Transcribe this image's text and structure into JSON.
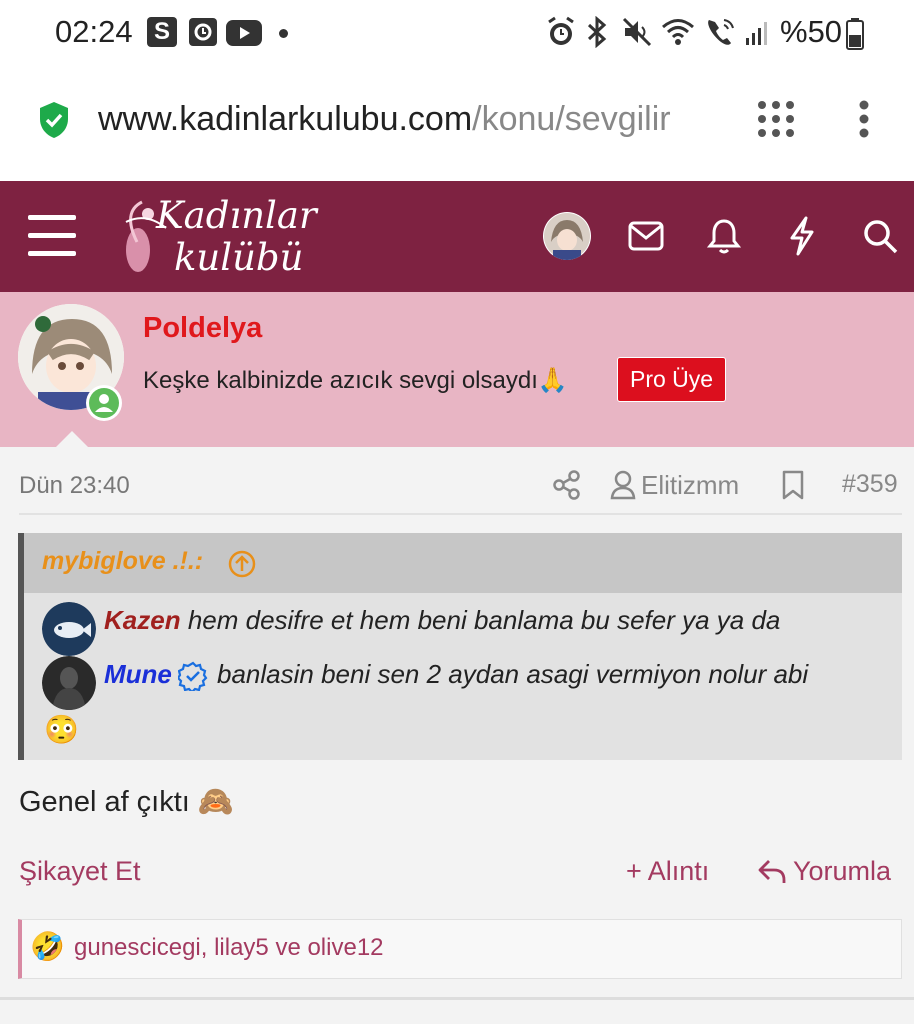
{
  "status_bar": {
    "time": "02:24",
    "s_badge": "S",
    "battery": "%50"
  },
  "browser": {
    "url_host": "www.kadinlarkulubu.com",
    "url_path": "/konu/sevgilir"
  },
  "site": {
    "logo_line1": "Kadınlar",
    "logo_line2": "kulübü",
    "header_color": "#7e2241"
  },
  "post": {
    "username": "Poldelya",
    "user_status": "Keşke kalbinizde azıcık sevgi olsaydı🙏",
    "badge": "Pro Üye",
    "date": "Dün 23:40",
    "author": "Elitizmm",
    "number": "#359",
    "quote": {
      "author": "mybiglove .!.:",
      "lines": [
        {
          "name": "Kazen",
          "text": "hem desifre et hem beni banlama bu sefer ya ya da"
        },
        {
          "name": "Mune",
          "text": "banlasin beni sen 2 aydan asagi vermiyon nolur abi"
        }
      ],
      "tail_emoji": "😳"
    },
    "body": "Genel af çıktı 🙈",
    "actions": {
      "report": "Şikayet Et",
      "quote": "+ Alıntı",
      "reply": "Yorumla"
    },
    "reactions": {
      "emoji": "🤣",
      "names": "gunescicegi, lilay5 ve olive12"
    }
  }
}
